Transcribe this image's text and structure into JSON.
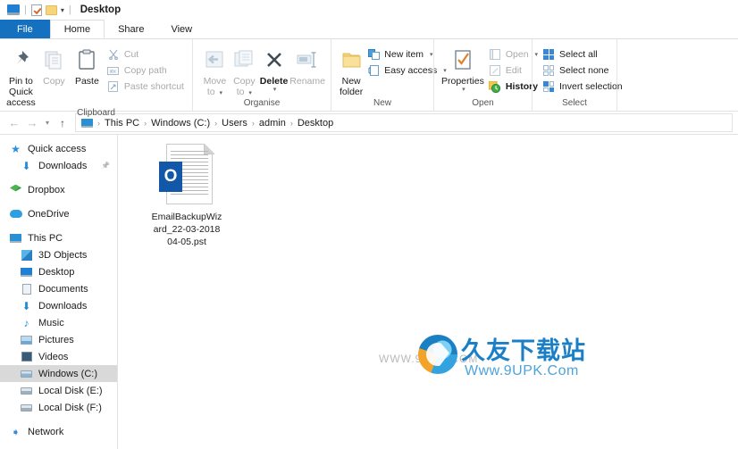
{
  "window": {
    "title": "Desktop",
    "quick_access_icons": [
      "explorer-icon",
      "properties-icon",
      "new-folder-icon"
    ],
    "customize_caret": "▾",
    "separator": "|"
  },
  "tabs": [
    {
      "label": "File",
      "name": "tab-file",
      "state": "file"
    },
    {
      "label": "Home",
      "name": "tab-home",
      "state": "active"
    },
    {
      "label": "Share",
      "name": "tab-share",
      "state": "normal"
    },
    {
      "label": "View",
      "name": "tab-view",
      "state": "normal"
    }
  ],
  "ribbon": {
    "groups": [
      {
        "label": "Clipboard",
        "big": [
          {
            "label": "Pin to Quick",
            "label2": "access",
            "icon": "pin-icon",
            "disabled": false
          },
          {
            "label": "Copy",
            "icon": "copy-icon",
            "disabled": true
          },
          {
            "label": "Paste",
            "icon": "paste-icon",
            "disabled": false
          }
        ],
        "small": [
          {
            "label": "Cut",
            "icon": "scissors-icon",
            "disabled": true
          },
          {
            "label": "Copy path",
            "icon": "copy-path-icon",
            "disabled": true
          },
          {
            "label": "Paste shortcut",
            "icon": "paste-shortcut-icon",
            "disabled": true
          }
        ]
      },
      {
        "label": "Organise",
        "big": [
          {
            "label": "Move",
            "label2": "to",
            "icon": "move-to-icon",
            "disabled": true,
            "caret": "▾"
          },
          {
            "label": "Copy",
            "label2": "to",
            "icon": "copy-to-icon",
            "disabled": true,
            "caret": "▾"
          },
          {
            "label": "Delete",
            "icon": "delete-icon",
            "disabled": false,
            "caret": "▾"
          },
          {
            "label": "Rename",
            "icon": "rename-icon",
            "disabled": true
          }
        ],
        "small": []
      },
      {
        "label": "New",
        "big": [
          {
            "label": "New",
            "label2": "folder",
            "icon": "new-folder-icon",
            "disabled": false
          }
        ],
        "small": [
          {
            "label": "New item",
            "icon": "new-item-icon",
            "disabled": false,
            "caret": "▾"
          },
          {
            "label": "Easy access",
            "icon": "easy-access-icon",
            "disabled": false,
            "caret": "▾"
          }
        ]
      },
      {
        "label": "Open",
        "big": [
          {
            "label": "Properties",
            "icon": "properties-icon",
            "disabled": false,
            "caret": "▾"
          }
        ],
        "small": [
          {
            "label": "Open",
            "icon": "open-icon",
            "disabled": true,
            "caret": "▾"
          },
          {
            "label": "Edit",
            "icon": "edit-icon",
            "disabled": true
          },
          {
            "label": "History",
            "icon": "history-icon",
            "disabled": false
          }
        ]
      },
      {
        "label": "Select",
        "big": [],
        "small": [
          {
            "label": "Select all",
            "icon": "select-all-icon",
            "disabled": false
          },
          {
            "label": "Select none",
            "icon": "select-none-icon",
            "disabled": false
          },
          {
            "label": "Invert selection",
            "icon": "invert-selection-icon",
            "disabled": false
          }
        ]
      }
    ]
  },
  "addressbar": {
    "back": "←",
    "forward": "→",
    "recent": "▾",
    "up": "↑",
    "crumb_icon": "this-pc-icon",
    "separator": "›",
    "crumbs": [
      "This PC",
      "Windows (C:)",
      "Users",
      "admin",
      "Desktop"
    ]
  },
  "sidebar": {
    "items": [
      {
        "label": "Quick access",
        "icon": "star-icon",
        "indent": 0,
        "selected": false,
        "pinned": false
      },
      {
        "label": "Downloads",
        "icon": "download-icon",
        "indent": 1,
        "selected": false,
        "pinned": true
      },
      {
        "gap": true
      },
      {
        "label": "Dropbox",
        "icon": "dropbox-icon",
        "indent": 0,
        "selected": false,
        "pinned": false
      },
      {
        "gap": true
      },
      {
        "label": "OneDrive",
        "icon": "onedrive-icon",
        "indent": 0,
        "selected": false,
        "pinned": false
      },
      {
        "gap": true
      },
      {
        "label": "This PC",
        "icon": "this-pc-icon",
        "indent": 0,
        "selected": false,
        "pinned": false
      },
      {
        "label": "3D Objects",
        "icon": "3d-objects-icon",
        "indent": 1,
        "selected": false,
        "pinned": false
      },
      {
        "label": "Desktop",
        "icon": "desktop-icon",
        "indent": 1,
        "selected": false,
        "pinned": false
      },
      {
        "label": "Documents",
        "icon": "documents-icon",
        "indent": 1,
        "selected": false,
        "pinned": false
      },
      {
        "label": "Downloads",
        "icon": "download-icon",
        "indent": 1,
        "selected": false,
        "pinned": false
      },
      {
        "label": "Music",
        "icon": "music-icon",
        "indent": 1,
        "selected": false,
        "pinned": false
      },
      {
        "label": "Pictures",
        "icon": "pictures-icon",
        "indent": 1,
        "selected": false,
        "pinned": false
      },
      {
        "label": "Videos",
        "icon": "videos-icon",
        "indent": 1,
        "selected": false,
        "pinned": false
      },
      {
        "label": "Windows (C:)",
        "icon": "drive-icon",
        "indent": 1,
        "selected": true,
        "pinned": false
      },
      {
        "label": "Local Disk (E:)",
        "icon": "drive-icon",
        "indent": 1,
        "selected": false,
        "pinned": false
      },
      {
        "label": "Local Disk (F:)",
        "icon": "drive-icon",
        "indent": 1,
        "selected": false,
        "pinned": false
      },
      {
        "gap": true
      },
      {
        "label": "Network",
        "icon": "network-icon",
        "indent": 0,
        "selected": false,
        "pinned": false
      }
    ]
  },
  "files": [
    {
      "name": "EmailBackupWizard_22-03-2018 04-05.pst",
      "display_lines": [
        "EmailBackupWiz",
        "ard_22-03-2018",
        "04-05.pst"
      ],
      "icon": "outlook-pst-file-icon",
      "badge_letter": "O"
    }
  ],
  "watermark": {
    "url_left": "WWW.9UPK.COM",
    "brand_cn": "久友下载站",
    "brand_url": "Www.9UPK.Com",
    "logo": "swoosh-logo-icon"
  },
  "colors": {
    "file_tab_blue": "#1570c0",
    "accent_blue": "#2a8fd8",
    "outlook_blue": "#1357a8",
    "selection_grey": "#d9d9d9",
    "watermark_blue": "#1a7fc6"
  }
}
